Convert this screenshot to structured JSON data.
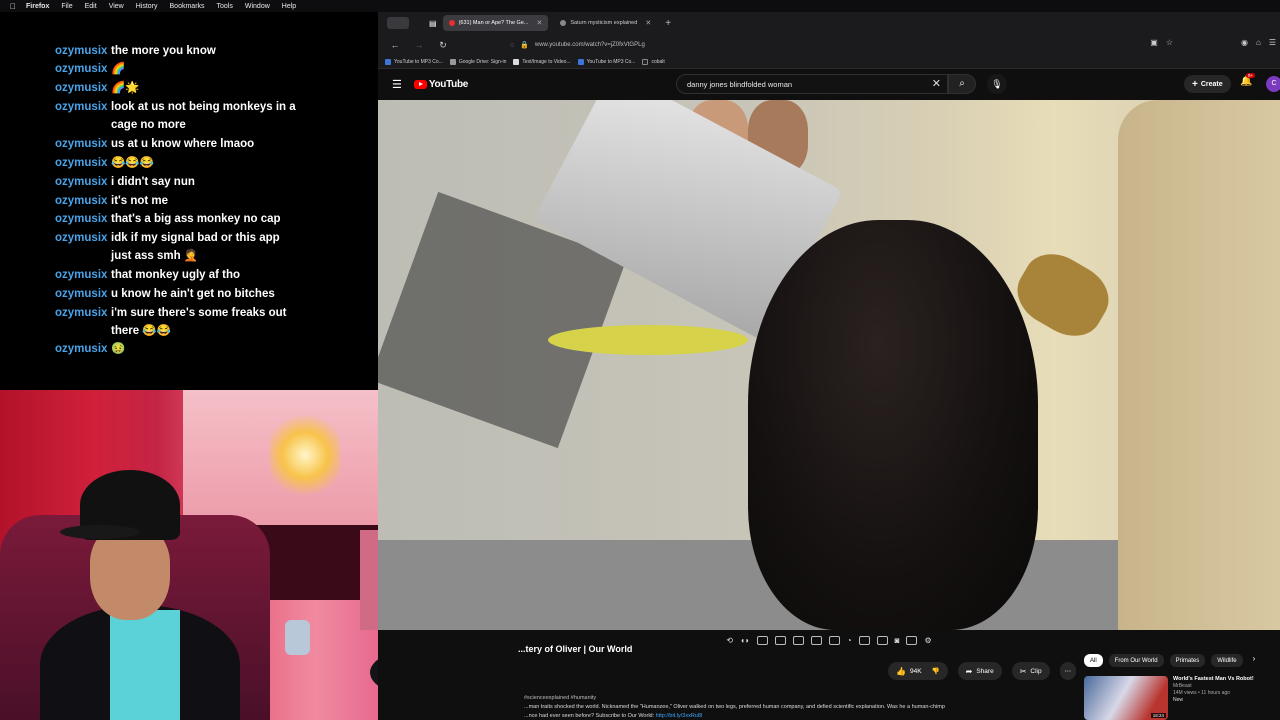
{
  "menubar": {
    "apple": "",
    "items": [
      "Firefox",
      "File",
      "Edit",
      "View",
      "History",
      "Bookmarks",
      "Tools",
      "Window",
      "Help"
    ]
  },
  "chat": {
    "messages": [
      {
        "user": "ozymusix",
        "text": "the more you know"
      },
      {
        "user": "ozymusix",
        "text": "🌈"
      },
      {
        "user": "ozymusix",
        "text": "🌈🌟"
      },
      {
        "user": "ozymusix",
        "text": "look at us not being monkeys in a cage no more"
      },
      {
        "user": "ozymusix",
        "text": "us at u know where lmaoo"
      },
      {
        "user": "ozymusix",
        "text": "😂😂😂"
      },
      {
        "user": "ozymusix",
        "text": "i didn't say nun"
      },
      {
        "user": "ozymusix",
        "text": "it's not me"
      },
      {
        "user": "ozymusix",
        "text": "that's a big ass monkey no cap"
      },
      {
        "user": "ozymusix",
        "text": "idk if my signal bad or this app just ass smh 🤦"
      },
      {
        "user": "ozymusix",
        "text": "that monkey ugly af tho"
      },
      {
        "user": "ozymusix",
        "text": "u know he ain't get no bitches"
      },
      {
        "user": "ozymusix",
        "text": "i'm sure there's some freaks out there 😂😂"
      },
      {
        "user": "ozymusix",
        "text": "🤢"
      }
    ]
  },
  "browser": {
    "tabs": [
      {
        "label": "(631) Man or Ape? The Ge...",
        "active": true
      },
      {
        "label": "Saturn mysticism explained",
        "active": false
      }
    ],
    "url": "www.youtube.com/watch?v=jZ0fxVtGPLg",
    "bookmarks": [
      "YouTube to MP3 Co...",
      "Google Drive: Sign-in",
      "Text/Image to Video...",
      "YouTube to MP3 Co...",
      "cobalt"
    ]
  },
  "youtube": {
    "logo": "YouTube",
    "search_value": "danny jones blindfolded woman",
    "create_label": "Create",
    "notif_badge": "9+",
    "avatar_letter": "C",
    "video_title": "...tery of Oliver | Our World",
    "likes": "94K",
    "share_label": "Share",
    "clip_label": "Clip",
    "description_tags": "#scienceexplained #humanity",
    "description_text": "...man traits shocked the world. Nicknamed the \"Humanzee,\" Oliver walked on two legs, preferred human company, and defied scientific explanation. Was he a human-chimp",
    "description_text2": "...nce had ever seen before? Subscribe to Our World:",
    "description_link": "http://bit.ly/3xxRu8I"
  },
  "sidebar_recs": {
    "chips": [
      "All",
      "From Our World",
      "Primates",
      "Wildlife"
    ],
    "items": [
      {
        "title": "World's Fastest Man Vs Robot!",
        "channel": "MrBeast",
        "stats": "14M views • 11 hours ago",
        "badge": "New",
        "duration": "18:24"
      }
    ]
  },
  "colors": {
    "username": "#4aa3e8",
    "youtube_red": "#ff0000",
    "link": "#3ea6ff"
  }
}
